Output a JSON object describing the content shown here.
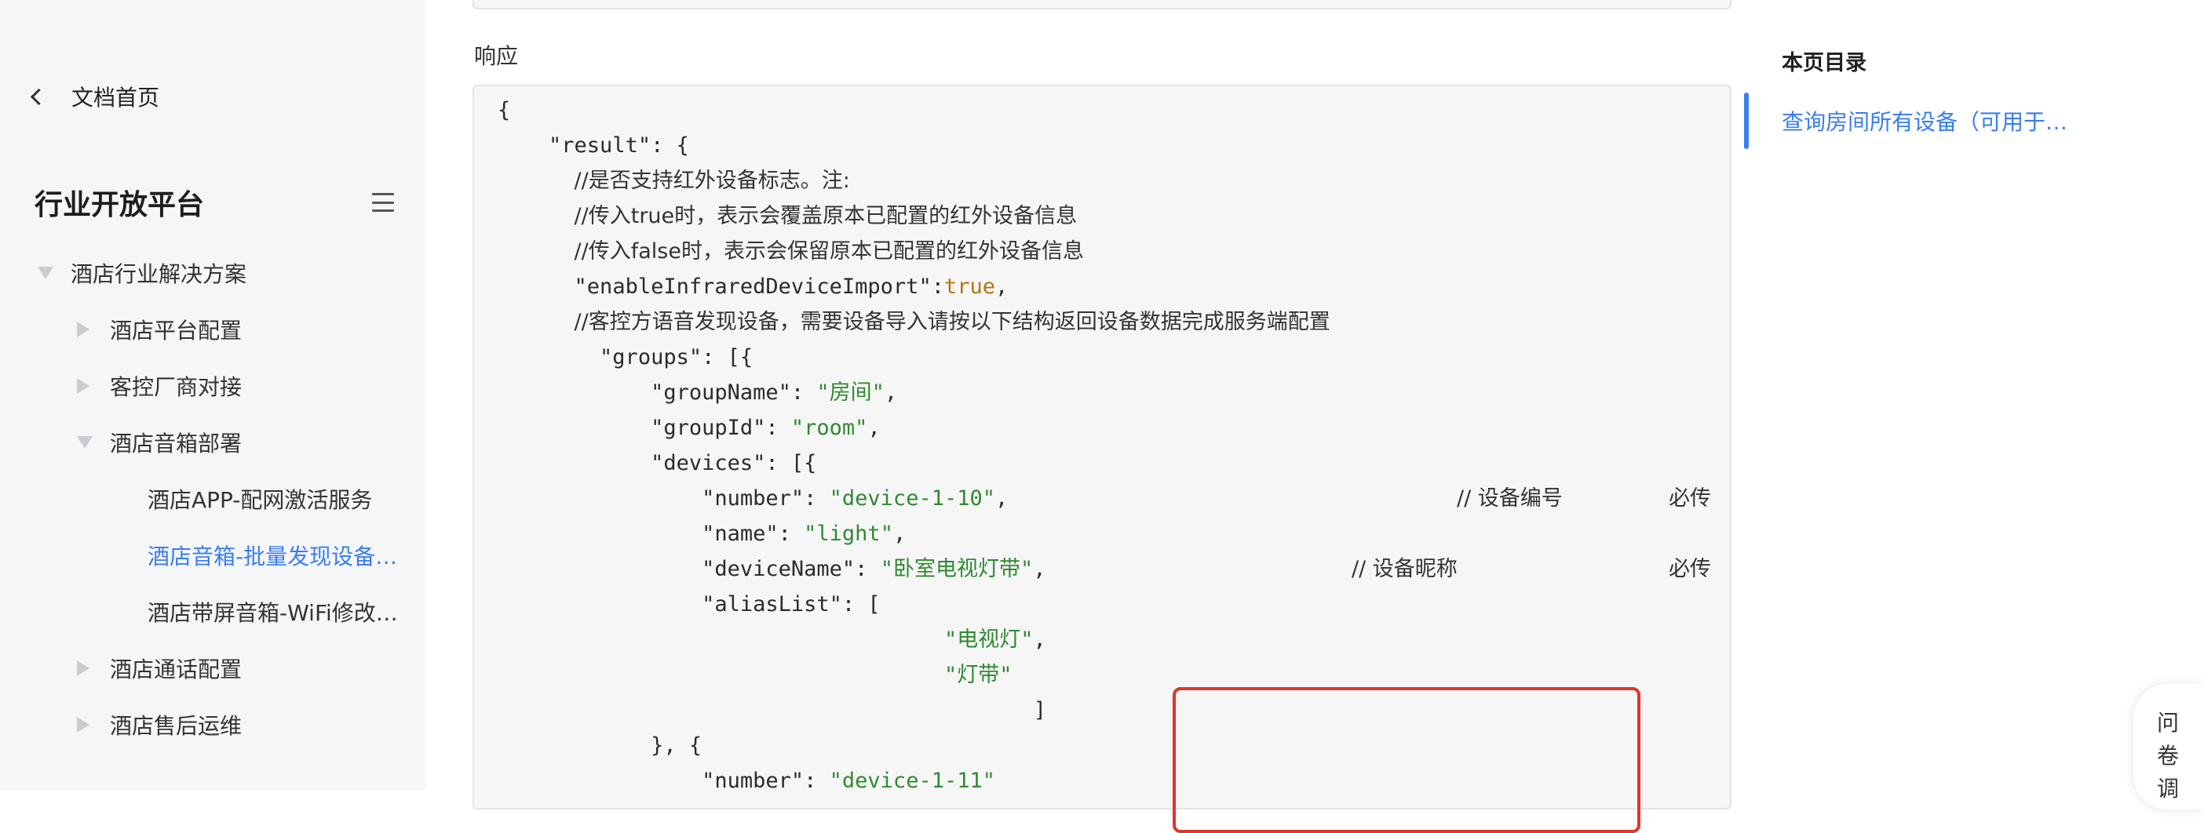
{
  "sidebar": {
    "back_label": "文档首页",
    "platform_title": "行业开放平台",
    "nav": [
      {
        "label": "酒店行业解决方案",
        "level": 0,
        "expanded": true
      },
      {
        "label": "酒店平台配置",
        "level": 1,
        "expanded": false
      },
      {
        "label": "客控厂商对接",
        "level": 1,
        "expanded": false
      },
      {
        "label": "酒店音箱部署",
        "level": 1,
        "expanded": true
      },
      {
        "label": "酒店APP-配网激活服务",
        "level": 2
      },
      {
        "label": "酒店音箱-批量发现设备…",
        "level": 2,
        "active": true
      },
      {
        "label": "酒店带屏音箱-WiFi修改…",
        "level": 2
      },
      {
        "label": "酒店通话配置",
        "level": 1,
        "expanded": false
      },
      {
        "label": "酒店售后运维",
        "level": 1,
        "expanded": false
      }
    ]
  },
  "main": {
    "section_label": "响应",
    "code": {
      "l01": "{",
      "l02_key": "\"result\"",
      "l02_rest": ": {",
      "l03": "//是否支持红外设备标志。注:",
      "l04": "//传入true时，表示会覆盖原本已配置的红外设备信息",
      "l05": "//传入false时，表示会保留原本已配置的红外设备信息",
      "l06_key": "\"enableInfraredDeviceImport\"",
      "l06_colon": ":",
      "l06_val": "true",
      "l06_end": ",",
      "l07": "//客控方语音发现设备，需要设备导入请按以下结构返回设备数据完成服务端配置",
      "l08_key": "\"groups\"",
      "l08_rest": ": [{",
      "l09_key": "\"groupName\"",
      "l09_val": "\"房间\"",
      "l10_key": "\"groupId\"",
      "l10_val": "\"room\"",
      "l11_key": "\"devices\"",
      "l11_rest": ": [{",
      "l12_key": "\"number\"",
      "l12_val": "\"device-1-10\"",
      "l12_cmt": "// 设备编号",
      "l12_req": "必传",
      "l13_key": "\"name\"",
      "l13_val": "\"light\"",
      "l14_key": "\"deviceName\"",
      "l14_val": "\"卧室电视灯带\"",
      "l14_cmt": "// 设备昵称",
      "l14_req": "必传",
      "l15_key": "\"aliasList\"",
      "l15_rest": ": [",
      "l16_val": "\"电视灯\"",
      "l17_val": "\"灯带\"",
      "l18": "]",
      "l19": "}, {",
      "l20_key": "\"number\"",
      "l20_val": "\"device-1-11\""
    }
  },
  "toc": {
    "title": "本页目录",
    "items": [
      "查询房间所有设备（可用于…"
    ]
  },
  "feedback": {
    "chars": [
      "问",
      "卷",
      "调"
    ]
  },
  "colors": {
    "accent": "#3a7df0",
    "string": "#2f8a32",
    "boolean": "#b8760e",
    "highlight": "#e0352b"
  }
}
